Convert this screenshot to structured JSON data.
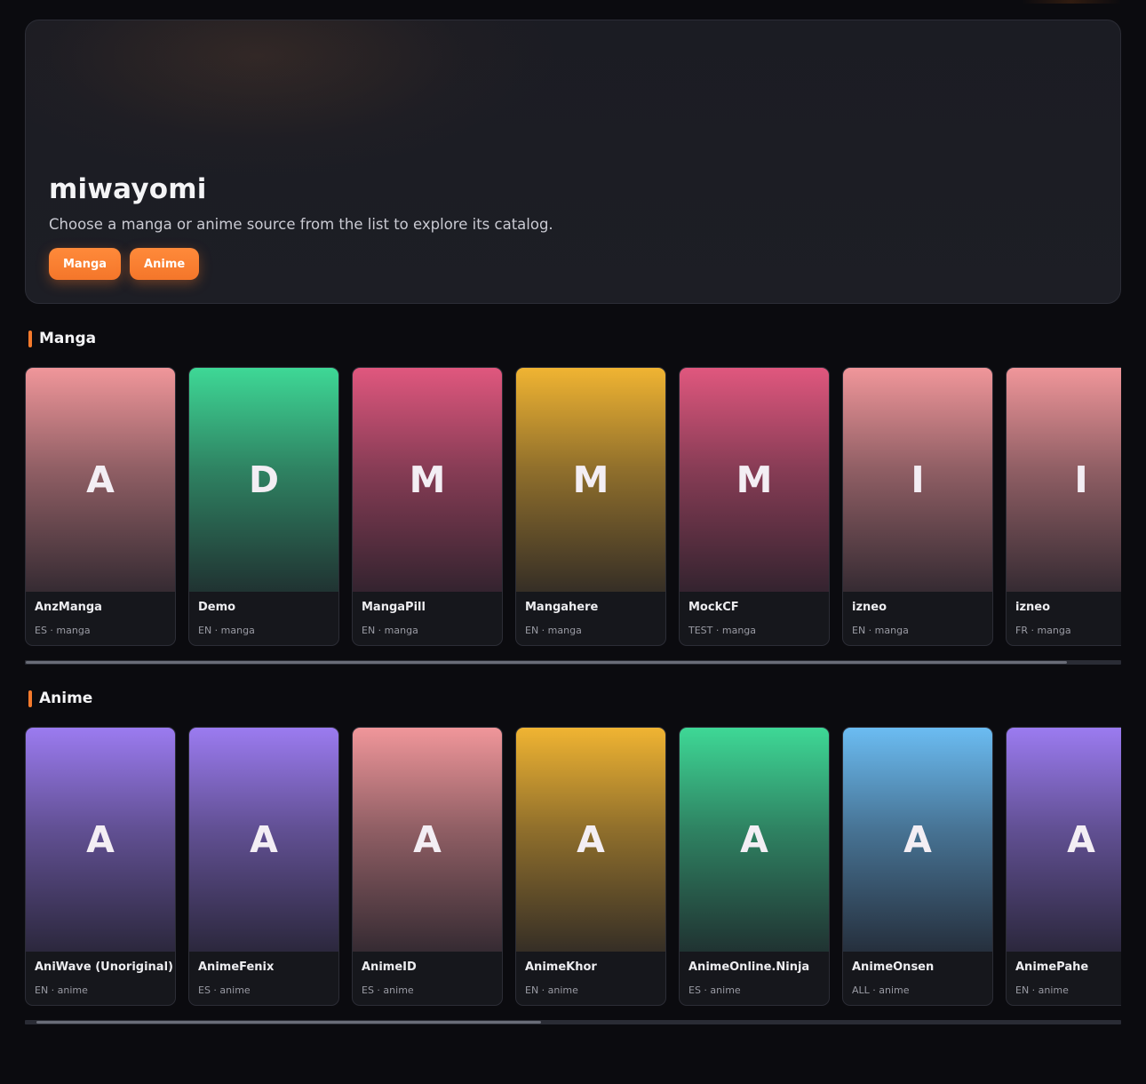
{
  "hero": {
    "title": "miwayomi",
    "subtitle": "Choose a manga or anime source from the list to explore its catalog.",
    "buttons": [
      {
        "label": "Manga"
      },
      {
        "label": "Anime"
      }
    ]
  },
  "manga": {
    "title": "Manga",
    "scroll_position": 0.95,
    "cards": [
      {
        "letter": "A",
        "name": "AnzManga",
        "meta": "ES · manga",
        "color": "#f0969a"
      },
      {
        "letter": "D",
        "name": "Demo",
        "meta": "EN · manga",
        "color": "#3ed896"
      },
      {
        "letter": "M",
        "name": "MangaPill",
        "meta": "EN · manga",
        "color": "#e0577e"
      },
      {
        "letter": "M",
        "name": "Mangahere",
        "meta": "EN · manga",
        "color": "#f0b432"
      },
      {
        "letter": "M",
        "name": "MockCF",
        "meta": "TEST · manga",
        "color": "#e0577e"
      },
      {
        "letter": "I",
        "name": "izneo",
        "meta": "EN · manga",
        "color": "#f0969a"
      },
      {
        "letter": "I",
        "name": "izneo",
        "meta": "FR · manga",
        "color": "#f0969a"
      }
    ]
  },
  "anime": {
    "title": "Anime",
    "scroll_position": 0.46,
    "cards": [
      {
        "letter": "A",
        "name": "AniWave (Unoriginal)",
        "meta": "EN · anime",
        "color": "#9b7bf0"
      },
      {
        "letter": "A",
        "name": "AnimeFenix",
        "meta": "ES · anime",
        "color": "#9b7bf0"
      },
      {
        "letter": "A",
        "name": "AnimeID",
        "meta": "ES · anime",
        "color": "#f0969a"
      },
      {
        "letter": "A",
        "name": "AnimeKhor",
        "meta": "EN · anime",
        "color": "#f0b432"
      },
      {
        "letter": "A",
        "name": "AnimeOnline.Ninja",
        "meta": "ES · anime",
        "color": "#3ed896"
      },
      {
        "letter": "A",
        "name": "AnimeOnsen",
        "meta": "ALL · anime",
        "color": "#6bbcf2"
      },
      {
        "letter": "A",
        "name": "AnimePahe",
        "meta": "EN · anime",
        "color": "#9b7bf0"
      }
    ]
  }
}
